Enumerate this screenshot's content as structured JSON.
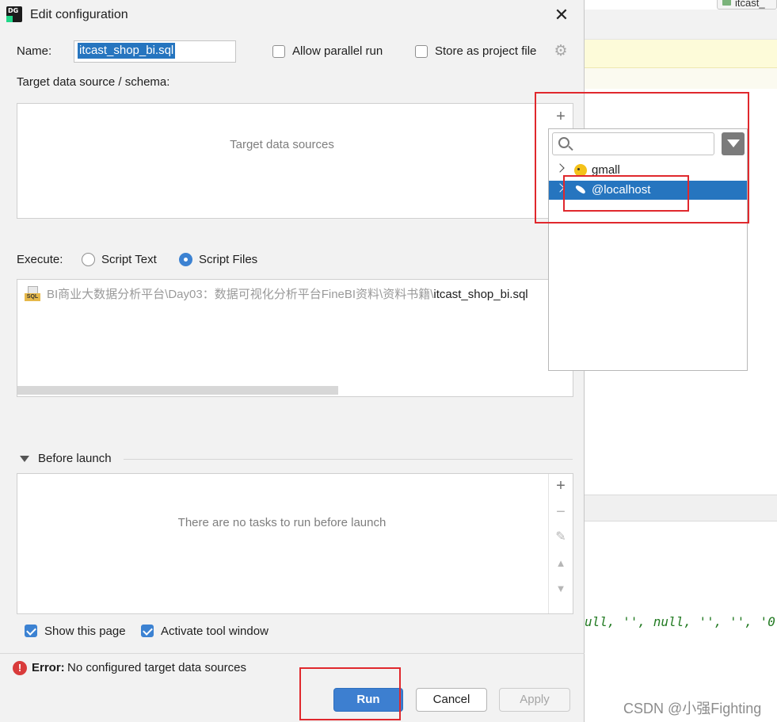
{
  "background": {
    "tab_label": "itcast_",
    "code_snippet": "ull, '', null, '', '', '0",
    "watermark": "CSDN @小强Fighting"
  },
  "dialog": {
    "title": "Edit configuration",
    "name_label": "Name:",
    "name_value": "itcast_shop_bi.sql",
    "allow_parallel_label": "Allow parallel run",
    "allow_parallel_checked": false,
    "store_project_label": "Store as project file",
    "store_project_checked": false,
    "target_label": "Target data source / schema:",
    "target_placeholder": "Target data sources",
    "execute_label": "Execute:",
    "execute_options": [
      {
        "label": "Script Text",
        "selected": false
      },
      {
        "label": "Script Files",
        "selected": true
      }
    ],
    "script_file": {
      "icon_tag": "SQL",
      "path_dim": "BI商业大数据分析平台\\Day03：数据可视化分析平台FineBI资料\\资料书籍\\",
      "path_main": "itcast_shop_bi.sql"
    },
    "before_launch_label": "Before launch",
    "before_launch_placeholder": "There are no tasks to run before launch",
    "show_page_label": "Show this page",
    "show_page_checked": true,
    "activate_tool_label": "Activate tool window",
    "activate_tool_checked": true,
    "error_prefix": "Error:",
    "error_text": "No configured target data sources",
    "buttons": {
      "run": "Run",
      "cancel": "Cancel",
      "apply": "Apply"
    }
  },
  "popup": {
    "search_placeholder": "",
    "items": [
      {
        "label": "gmall",
        "icon": "hadoop-hive-icon",
        "selected": false
      },
      {
        "label": "@localhost",
        "icon": "mysql-dolphin-icon",
        "selected": true
      }
    ]
  },
  "colors": {
    "accent": "#2675bf",
    "run_button": "#3d7fd0",
    "annotation_red": "#e0282d",
    "error": "#d93b3b"
  }
}
